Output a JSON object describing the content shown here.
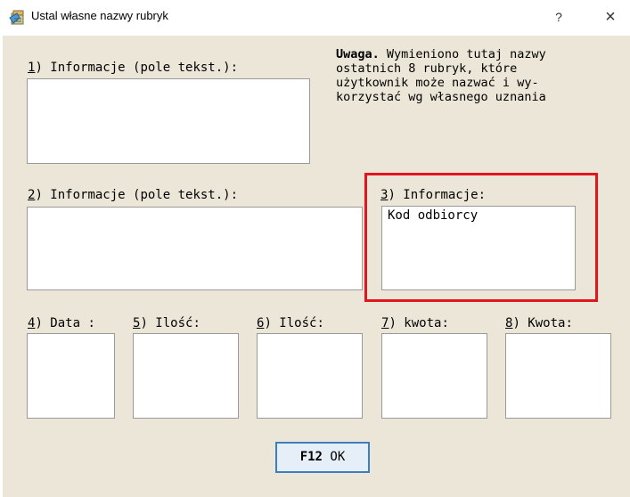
{
  "window": {
    "title": "Ustal własne nazwy rubryk",
    "help_label": "?",
    "close_label": "×"
  },
  "fields": [
    {
      "num": "1",
      "label": ") Informacje (pole tekst.):",
      "value": ""
    },
    {
      "num": "2",
      "label": ") Informacje (pole tekst.):",
      "value": ""
    },
    {
      "num": "3",
      "label": ") Informacje:",
      "value": "Kod odbiorcy"
    },
    {
      "num": "4",
      "label": ") Data :",
      "value": ""
    },
    {
      "num": "5",
      "label": ") Ilość:",
      "value": ""
    },
    {
      "num": "6",
      "label": ") Ilość:",
      "value": ""
    },
    {
      "num": "7",
      "label": ") kwota:",
      "value": ""
    },
    {
      "num": "8",
      "label": ") Kwota:",
      "value": ""
    }
  ],
  "note": {
    "bold": "Uwaga.",
    "text": " Wymieniono tutaj nazwy\nostatnich 8 rubryk, które\nużytkownik może nazwać i wy-\nkorzystać wg własnego uznania"
  },
  "ok_button": {
    "key": "F12",
    "label": " OK"
  },
  "colors": {
    "dialog_background": "#ece6d8",
    "highlight": "#e3161e",
    "button_border": "#3c7fc0"
  }
}
